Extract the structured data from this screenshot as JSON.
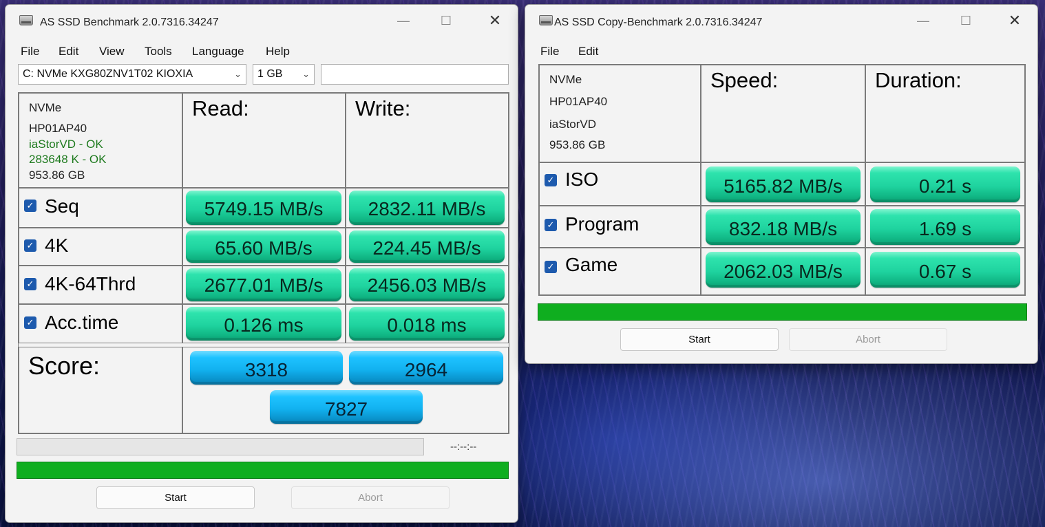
{
  "left_window": {
    "title": "AS SSD Benchmark 2.0.7316.34247",
    "menu": [
      "File",
      "Edit",
      "View",
      "Tools",
      "Language",
      "Help"
    ],
    "drive_select": "C: NVMe KXG80ZNV1T02 KIOXIA",
    "size_select": "1 GB",
    "info": {
      "line1": "NVMe",
      "line2": "HP01AP40",
      "line3": "iaStorVD - OK",
      "line4": "283648 K - OK",
      "line5": "953.86 GB"
    },
    "headers": {
      "read": "Read:",
      "write": "Write:"
    },
    "rows": [
      {
        "label": "Seq",
        "read": "5749.15 MB/s",
        "write": "2832.11 MB/s",
        "checked": true
      },
      {
        "label": "4K",
        "read": "65.60 MB/s",
        "write": "224.45 MB/s",
        "checked": true
      },
      {
        "label": "4K-64Thrd",
        "read": "2677.01 MB/s",
        "write": "2456.03 MB/s",
        "checked": true
      },
      {
        "label": "Acc.time",
        "read": "0.126 ms",
        "write": "0.018 ms",
        "checked": true
      }
    ],
    "score": {
      "label": "Score:",
      "read": "3318",
      "write": "2964",
      "total": "7827"
    },
    "timer": "--:--:--",
    "buttons": {
      "start": "Start",
      "abort": "Abort"
    },
    "colors": {
      "result": "#1fd39f",
      "score": "#12b2f0",
      "progress": "#0fae1f"
    }
  },
  "right_window": {
    "title": "AS SSD Copy-Benchmark 2.0.7316.34247",
    "menu": [
      "File",
      "Edit"
    ],
    "info": {
      "line1": "NVMe",
      "line2": "HP01AP40",
      "line3": "iaStorVD",
      "line4": "953.86 GB"
    },
    "headers": {
      "speed": "Speed:",
      "duration": "Duration:"
    },
    "rows": [
      {
        "label": "ISO",
        "speed": "5165.82 MB/s",
        "duration": "0.21 s",
        "checked": true
      },
      {
        "label": "Program",
        "speed": "832.18 MB/s",
        "duration": "1.69 s",
        "checked": true
      },
      {
        "label": "Game",
        "speed": "2062.03 MB/s",
        "duration": "0.67 s",
        "checked": true
      }
    ],
    "buttons": {
      "start": "Start",
      "abort": "Abort"
    }
  }
}
